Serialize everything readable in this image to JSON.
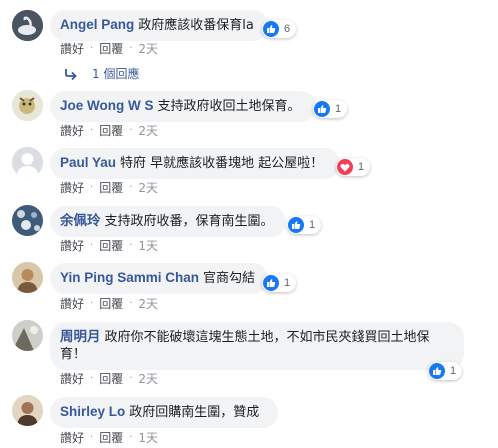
{
  "comments": [
    {
      "author": "Angel Pang",
      "text": "政府應該收番保育la",
      "reaction_type": "like",
      "reaction_count": "6",
      "time": "2天"
    },
    {
      "author": "Joe Wong W S",
      "text": "支持政府收回土地保育。",
      "reaction_type": "like",
      "reaction_count": "1",
      "time": "2天"
    },
    {
      "author": "Paul Yau",
      "text": "特府 早就應該收番塊地 起公屋啦！",
      "reaction_type": "love",
      "reaction_count": "1",
      "time": "2天"
    },
    {
      "author": "余佩玲",
      "text": "支持政府收番，保育南生圍。",
      "reaction_type": "like",
      "reaction_count": "1",
      "time": "1天"
    },
    {
      "author": "Yin Ping Sammi Chan",
      "text": "官商勾結",
      "reaction_type": "like",
      "reaction_count": "1",
      "time": "2天"
    },
    {
      "author": "周明月",
      "text": "政府你不能破壞這塊生態土地，不如市民夾錢買回土地保育！",
      "reaction_type": "like",
      "reaction_count": "1",
      "time": "2天"
    },
    {
      "author": "Shirley Lo",
      "text": "政府回購南生圍，贊成",
      "reaction_type": "",
      "reaction_count": "",
      "time": "1天"
    }
  ],
  "actions": {
    "like_label": "讚好",
    "reply_label": "回覆",
    "dot": "·"
  },
  "replies_link": "1 個回應",
  "colors": {
    "author": "#385898",
    "bubble": "#f2f3f5",
    "like": "#1877f2",
    "love": "#f33e58"
  }
}
